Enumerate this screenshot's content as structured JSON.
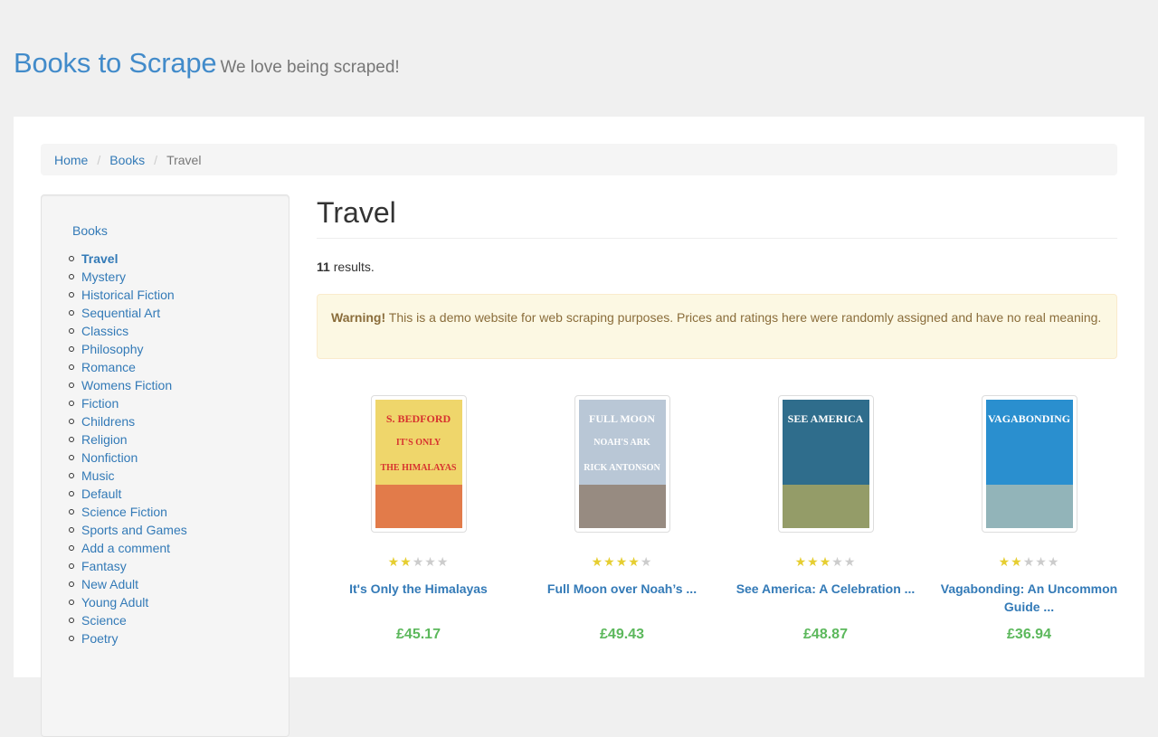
{
  "header": {
    "brand": "Books to Scrape",
    "tagline": "We love being scraped!"
  },
  "breadcrumb": {
    "home": "Home",
    "books": "Books",
    "current": "Travel",
    "separator": "/"
  },
  "sidebar": {
    "books_label": "Books",
    "categories": [
      "Travel",
      "Mystery",
      "Historical Fiction",
      "Sequential Art",
      "Classics",
      "Philosophy",
      "Romance",
      "Womens Fiction",
      "Fiction",
      "Childrens",
      "Religion",
      "Nonfiction",
      "Music",
      "Default",
      "Science Fiction",
      "Sports and Games",
      "Add a comment",
      "Fantasy",
      "New Adult",
      "Young Adult",
      "Science",
      "Poetry"
    ],
    "active_index": 0
  },
  "main": {
    "title": "Travel",
    "results_count": "11",
    "results_suffix": " results.",
    "warning_strong": "Warning!",
    "warning_text": " This is a demo website for web scraping purposes. Prices and ratings here were randomly assigned and have no real meaning."
  },
  "products": [
    {
      "title": "It's Only the Himalayas",
      "price": "£45.17",
      "rating": 2,
      "cover": {
        "lines": [
          "S. BEDFORD",
          "IT'S ONLY",
          "THE HIMALAYAS"
        ],
        "bg": "#efd66b",
        "accent": "#d7322f"
      }
    },
    {
      "title": "Full Moon over Noah’s ...",
      "price": "£49.43",
      "rating": 4,
      "cover": {
        "lines": [
          "FULL MOON",
          "NOAH'S ARK",
          "RICK ANTONSON"
        ],
        "bg": "#b9c7d6",
        "accent": "#7c5a3c"
      }
    },
    {
      "title": "See America: A Celebration ...",
      "price": "£48.87",
      "rating": 3,
      "cover": {
        "lines": [
          "SEE AMERICA"
        ],
        "bg": "#2f6d8c",
        "accent": "#e8c24a"
      }
    },
    {
      "title": "Vagabonding: An Uncommon Guide ...",
      "price": "£36.94",
      "rating": 2,
      "cover": {
        "lines": [
          "VAGABONDING"
        ],
        "bg": "#2a8fcf",
        "accent": "#e7d3a8"
      }
    }
  ],
  "colors": {
    "link": "#337ab7",
    "brand": "#428bca",
    "price": "#5cb85c",
    "star": "#e6ce31"
  },
  "icons": {
    "star": "star-icon"
  }
}
